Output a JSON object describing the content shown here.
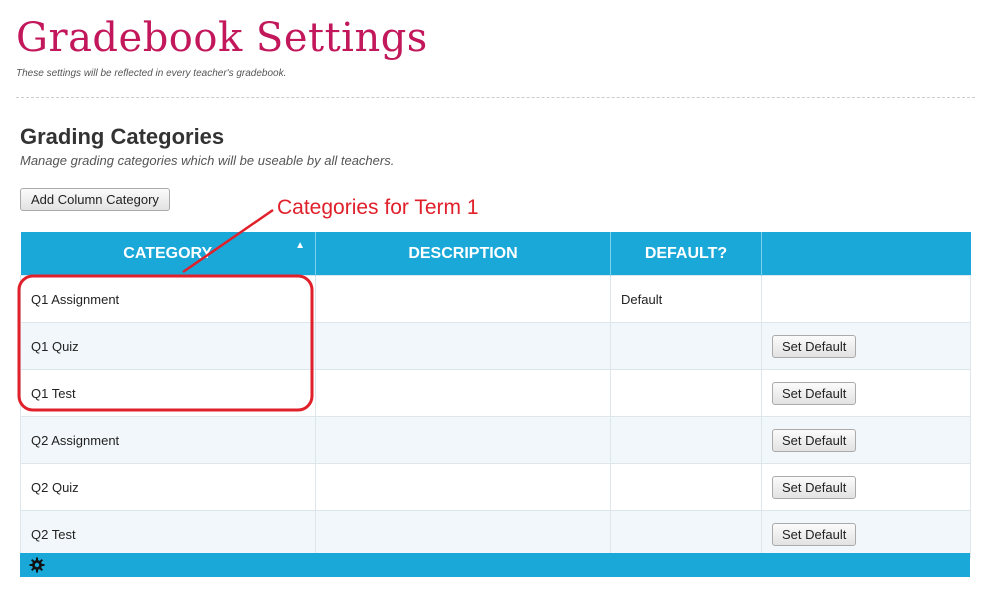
{
  "page": {
    "title": "Gradebook Settings",
    "subtitle": "These settings will be reflected in every teacher's gradebook."
  },
  "section": {
    "title": "Grading Categories",
    "subtitle": "Manage grading categories which will be useable by all teachers.",
    "add_button_label": "Add Column Category"
  },
  "annotation": {
    "text": "Categories for Term 1",
    "color": "#e0202a"
  },
  "table": {
    "headers": [
      "CATEGORY",
      "DESCRIPTION",
      "DEFAULT?",
      ""
    ],
    "sort_indicator": "▲",
    "header_color": "#1aa8d9",
    "rows": [
      {
        "category": "Q1 Assignment",
        "description": "",
        "default": "Default",
        "action": ""
      },
      {
        "category": "Q1 Quiz",
        "description": "",
        "default": "",
        "action": "Set Default"
      },
      {
        "category": "Q1 Test",
        "description": "",
        "default": "",
        "action": "Set Default"
      },
      {
        "category": "Q2 Assignment",
        "description": "",
        "default": "",
        "action": "Set Default"
      },
      {
        "category": "Q2 Quiz",
        "description": "",
        "default": "",
        "action": "Set Default"
      },
      {
        "category": "Q2 Test",
        "description": "",
        "default": "",
        "action": "Set Default"
      }
    ]
  },
  "footer": {
    "icon": "gear-icon"
  }
}
